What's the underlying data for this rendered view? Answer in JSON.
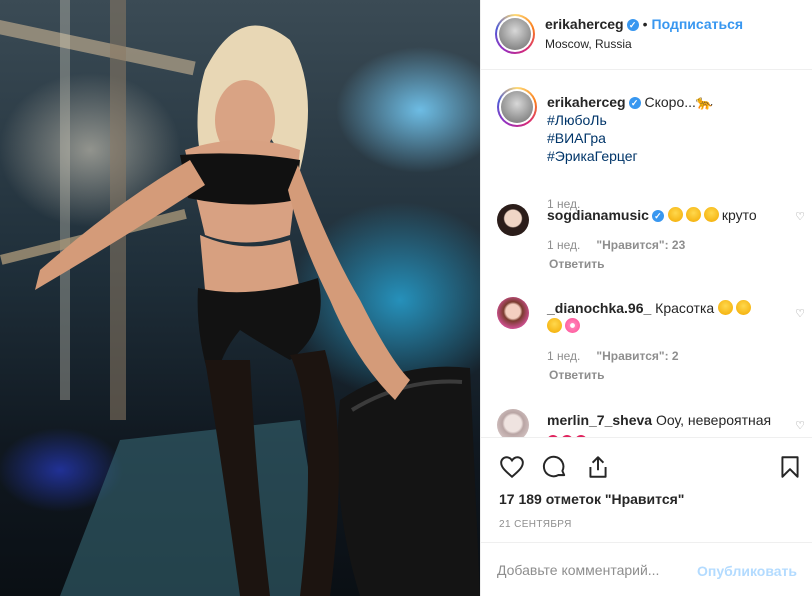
{
  "photo": {
    "alt": "post-photo"
  },
  "header": {
    "username": "erikaherceg",
    "separator": "•",
    "follow_label": "Подписаться",
    "location": "Moscow, Russia"
  },
  "caption": {
    "username": "erikaherceg",
    "text": "Скоро...🐆",
    "hashtags": [
      "#ЛюбоЛь",
      "#ВИАГра",
      "#ЭрикаГерцег"
    ],
    "time": "1 нед."
  },
  "comments": [
    {
      "username": "sogdianamusic",
      "text": "круто",
      "emoji_before": [
        "heart-eyes-emoji",
        "heart-eyes-emoji",
        "heart-eyes-emoji"
      ],
      "time": "1 нед.",
      "likes": "\"Нравится\": 23",
      "reply_label": "Ответить"
    },
    {
      "username": "_dianochka.96_",
      "text": "Красотка",
      "time": "1 нед.",
      "likes": "\"Нравится\": 2",
      "reply_label": "Ответить"
    },
    {
      "username": "merlin_7_sheva",
      "text": "Ооу, невероятная"
    }
  ],
  "actions": {
    "likes_count": "17 189 отметок \"Нравится\"",
    "date": "21 СЕНТЯБРЯ"
  },
  "add_comment": {
    "placeholder": "Добавьте комментарий...",
    "publish_label": "Опубликовать"
  },
  "colors": {
    "link": "#3897f0",
    "hashtag": "#003569",
    "muted": "#8e8e8e",
    "publish_disabled": "#b3dbff"
  }
}
